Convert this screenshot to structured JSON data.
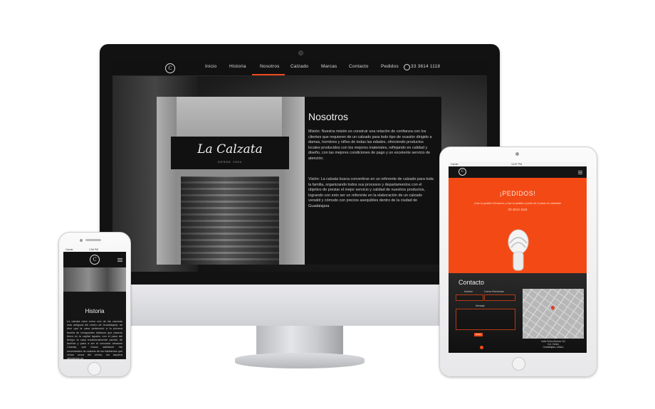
{
  "desktop": {
    "nav": {
      "logo_letter": "C",
      "items": [
        "Inicio",
        "Historia",
        "Nosotros",
        "Calzado",
        "Marcas",
        "Contacto",
        "Pedidos"
      ],
      "active_index": 2,
      "phone": "33 3614 1118"
    },
    "store_sign": "La Calzata",
    "store_sign_sub": "DESDE 1994",
    "section_title": "Nosotros",
    "mision": "Misión: Nuestra misión es construir una relación de confianza con los clientes que requieren de un calzado para todo tipo de ocasión dirigido a damas, hombres y niños de todas las edades, ofreciendo productos locales producidos con los mejores materiales, reflejando en calidad y diseño, con las mejores condiciones de pago y un excelente servicio de atención.",
    "vision": "Visión: La calzata busca convertirse en un referente de calzado para toda la familia, organizando todos sus procesos y departamentos con el objetivo de prestar el mejor servicio y calidad de nuestros productos, logrando con esto ser un referente en la elaboración de un calzado versátil y cómodo con precios asequibles dentro de la ciudad de Guadalajara"
  },
  "phone": {
    "status_carrier": "Carrier",
    "status_time": "1:56 PM",
    "logo_letter": "C",
    "section_title": "Historia",
    "text": "La calzata nace como una de las casonas más antiguas del centro de Guadalajara, se dice que la casa perteneció a la primera familia de inmigrantes italianos que pisaron tierra en la capital tapatía, con el paso del tiempo la casa tradicionalmente cambió de dueños y pasó a ser el conocido almacén Calzata, que busca satisfacer las necesidades de calzado de los habitantes que vivían cerca del centro, sin siquiera ofreciendo un"
  },
  "tablet": {
    "status_carrier": "Carrier",
    "status_time": "12:57 PM",
    "logo_letter": "C",
    "pedidos_title": "¡PEDIDOS!",
    "pedidos_sub": "¡Haz tu pedido! Envíanos y haz tu pedido a partir de 6 pares en adelante",
    "pedidos_phone": "33 3614 1118",
    "contact_title": "Contacto",
    "label_nombre": "Nombre",
    "label_correo": "Correo Electrónico",
    "label_mensaje": "Mensaje",
    "send_label": "Enviar",
    "address_line1": "Calle Pedro Moreno 111",
    "address_line2": "Col. Centro",
    "address_line3": "Guadalajara, Jalisco"
  },
  "colors": {
    "accent": "#f34a15",
    "dark": "#111111"
  }
}
